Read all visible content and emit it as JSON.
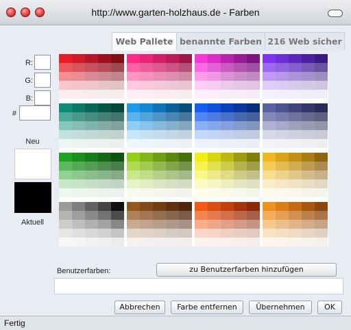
{
  "window": {
    "title": "http://www.garten-holzhaus.de - Farben"
  },
  "tabs": [
    {
      "label": "Web Pallete",
      "active": true
    },
    {
      "label": "benannte Farben",
      "active": false
    },
    {
      "label": "216 Web sicher",
      "active": false
    }
  ],
  "channels": {
    "r_label": "R:",
    "g_label": "G:",
    "b_label": "B:",
    "hex_label": "#",
    "r_value": "",
    "g_value": "",
    "b_value": "",
    "hex_value": ""
  },
  "swatches": {
    "new_label": "Neu",
    "new_color": "#ffffff",
    "current_label": "Aktuell",
    "current_color": "#000000"
  },
  "custom_colors": {
    "label": "Benutzerfarben:",
    "add_button": "zu Benutzerfarben hinzufügen"
  },
  "buttons": {
    "cancel": "Abbrechen",
    "remove": "Farbe entfernen",
    "apply": "Übernehmen",
    "ok": "OK"
  },
  "status": {
    "text": "Fertig"
  },
  "palette": {
    "blocks": [
      [
        [
          "#e51f25",
          "#cf1b26",
          "#b7152a",
          "#9b1120",
          "#7f0e17"
        ],
        [
          "#ff2a86",
          "#ea2477",
          "#d31f69",
          "#ba1b5b",
          "#9e1646"
        ],
        [
          "#f637d5",
          "#db2cc7",
          "#b823ad",
          "#9a1b96",
          "#7f1582"
        ],
        [
          "#7f33f0",
          "#6c2fd6",
          "#5a28bb",
          "#4a219e",
          "#3b1a83"
        ]
      ],
      [
        [
          "#0f8c77",
          "#0b7866",
          "#086656",
          "#075547",
          "#05463a"
        ],
        [
          "#1e9aea",
          "#1586d2",
          "#0f73b7",
          "#0c5f99",
          "#0a4c7b"
        ],
        [
          "#155cf2",
          "#0f4ed8",
          "#0b41b8",
          "#08369a",
          "#062c7c"
        ],
        [
          "#5b61a3",
          "#4c5291",
          "#3f447d",
          "#333769",
          "#282b55"
        ]
      ],
      [
        [
          "#22a226",
          "#1c8e20",
          "#187b1b",
          "#136716",
          "#0f5311"
        ],
        [
          "#96cf17",
          "#82b815",
          "#6fa012",
          "#5a880f",
          "#47700c"
        ],
        [
          "#f1ee13",
          "#d8d512",
          "#bcb910",
          "#9d9a0d",
          "#807e0b"
        ],
        [
          "#f0b81d",
          "#dba31a",
          "#c48f16",
          "#aa7a13",
          "#8f6510"
        ]
      ],
      [
        [
          "#9a9a9a",
          "#7e7e7e",
          "#626262",
          "#444444",
          "#111111"
        ],
        [
          "#96571f",
          "#84491a",
          "#723d15",
          "#603110",
          "#4e270c"
        ],
        [
          "#f25a14",
          "#db4d11",
          "#c2400e",
          "#a6340b",
          "#8b2908"
        ],
        [
          "#f0901d",
          "#db7c18",
          "#c36a13",
          "#a7570f",
          "#8b460b"
        ]
      ]
    ],
    "tints": [
      0,
      0.25,
      0.5,
      0.75,
      0.92
    ]
  }
}
